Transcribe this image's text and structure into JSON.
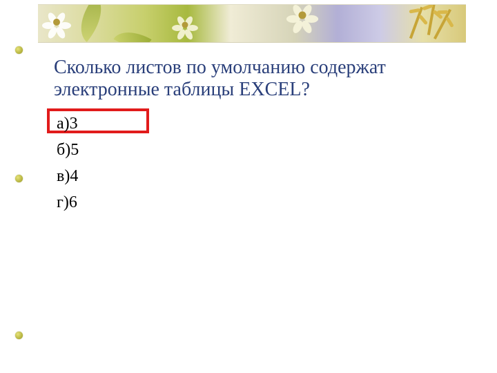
{
  "question": "Сколько листов по умолчанию содержат электронные таблицы EXCEL?",
  "options": {
    "a": "а)3",
    "b": "б)5",
    "c": "в)4",
    "d": "г)6"
  },
  "correct_option": "a"
}
